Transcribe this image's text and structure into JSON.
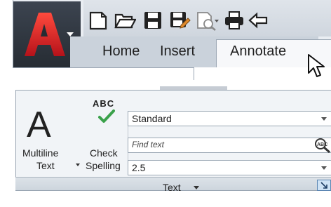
{
  "app_menu": {
    "icon": "autocad-a-icon"
  },
  "quick_access": {
    "icons": [
      "new-document-icon",
      "open-folder-icon",
      "save-icon",
      "save-as-icon",
      "plot-preview-icon",
      "print-icon",
      "undo-icon"
    ]
  },
  "tabs": [
    {
      "label": "Home"
    },
    {
      "label": "Insert"
    },
    {
      "label": "Annotate",
      "active": true
    }
  ],
  "text_panel": {
    "multiline": {
      "line1": "Multiline",
      "line2": "Text"
    },
    "check": {
      "abc": "ABC",
      "line1": "Check",
      "line2": "Spelling"
    },
    "style_value": "Standard",
    "find_placeholder": "Find text",
    "height_value": "2.5",
    "title": "Text"
  },
  "colors": {
    "accent": "#d9232d",
    "check_green": "#3aa14a",
    "panel_bg": "#f1f4f7"
  }
}
